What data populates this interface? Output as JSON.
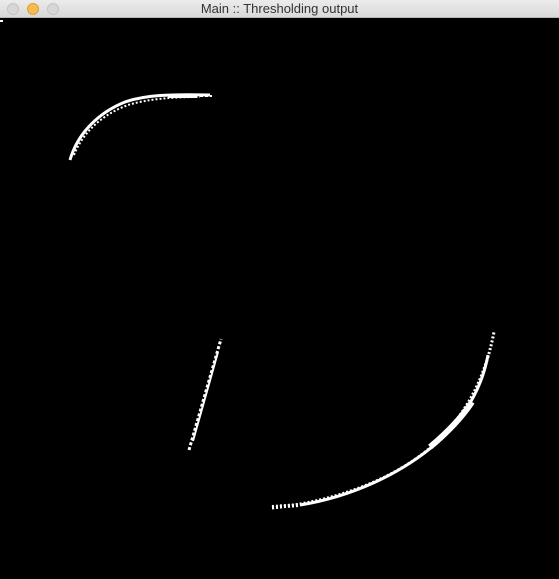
{
  "window": {
    "title": "Main :: Thresholding output",
    "controls": {
      "close": "close-button",
      "minimize": "minimize-button",
      "zoom": "zoom-button"
    }
  },
  "colors": {
    "background": "#000000",
    "foreground": "#ffffff",
    "minimize_accent": "#f5bd4f"
  }
}
